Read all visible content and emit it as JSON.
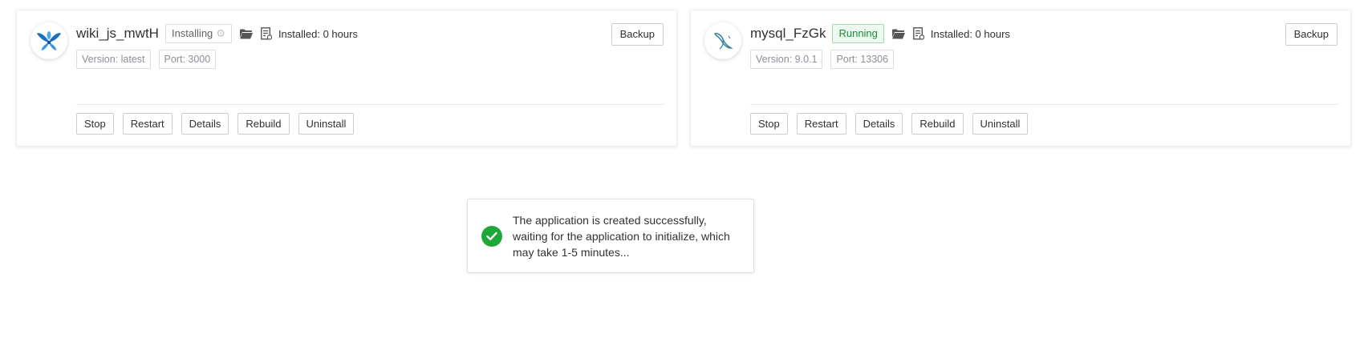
{
  "apps": [
    {
      "name": "wiki_js_mwtH",
      "status": "Installing",
      "status_kind": "installing",
      "installed": "Installed: 0 hours",
      "version": "Version: latest",
      "port": "Port: 3000",
      "backup_label": "Backup",
      "icon": "wiki-js-logo-icon",
      "actions": [
        "Stop",
        "Restart",
        "Details",
        "Rebuild",
        "Uninstall"
      ]
    },
    {
      "name": "mysql_FzGk",
      "status": "Running",
      "status_kind": "running",
      "installed": "Installed: 0 hours",
      "version": "Version: 9.0.1",
      "port": "Port: 13306",
      "backup_label": "Backup",
      "icon": "mysql-logo-icon",
      "actions": [
        "Stop",
        "Restart",
        "Details",
        "Rebuild",
        "Uninstall"
      ]
    }
  ],
  "toast": {
    "message": "The application is created successfully, waiting for the application to initialize, which may take 1-5 minutes...",
    "icon": "check-circle-icon",
    "color": "#1fa83a"
  },
  "colors": {
    "running_text": "#1a8a3a",
    "running_bg": "#edf9ee",
    "border": "#dcdfe6"
  }
}
